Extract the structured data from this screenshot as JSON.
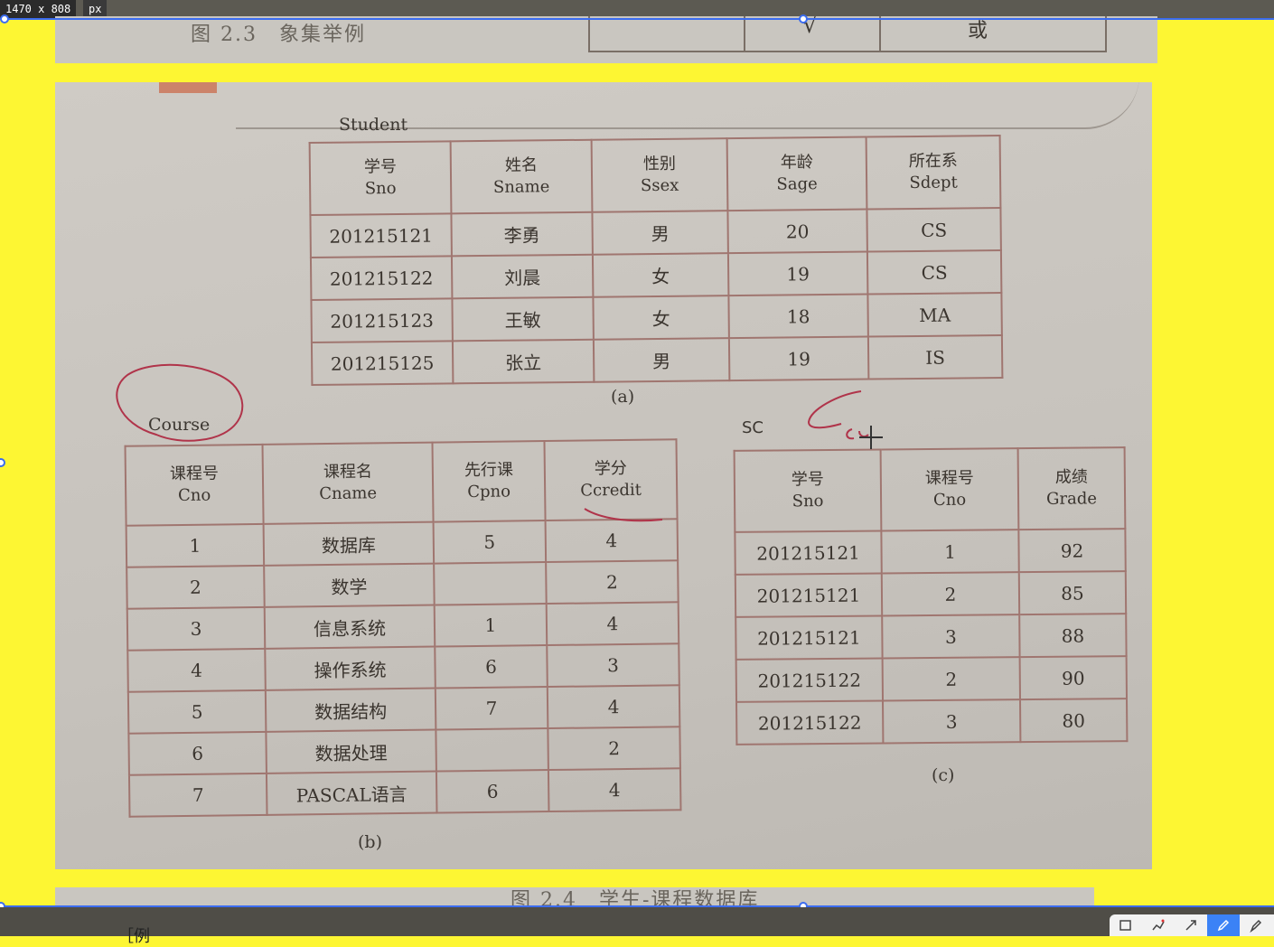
{
  "overlay": {
    "dimensions": "1470 x 808",
    "unit": "px"
  },
  "top_strip": {
    "caption": "图 2.3　象集举例",
    "table_check": "√",
    "table_or": "或"
  },
  "student": {
    "title": "Student",
    "headers": [
      {
        "cn": "学号",
        "en": "Sno"
      },
      {
        "cn": "姓名",
        "en": "Sname"
      },
      {
        "cn": "性别",
        "en": "Ssex"
      },
      {
        "cn": "年龄",
        "en": "Sage"
      },
      {
        "cn": "所在系",
        "en": "Sdept"
      }
    ],
    "rows": [
      [
        "201215121",
        "李勇",
        "男",
        "20",
        "CS"
      ],
      [
        "201215122",
        "刘晨",
        "女",
        "19",
        "CS"
      ],
      [
        "201215123",
        "王敏",
        "女",
        "18",
        "MA"
      ],
      [
        "201215125",
        "张立",
        "男",
        "19",
        "IS"
      ]
    ],
    "caption": "(a)"
  },
  "course": {
    "title": "Course",
    "headers": [
      {
        "cn": "课程号",
        "en": "Cno"
      },
      {
        "cn": "课程名",
        "en": "Cname"
      },
      {
        "cn": "先行课",
        "en": "Cpno"
      },
      {
        "cn": "学分",
        "en": "Ccredit"
      }
    ],
    "rows": [
      [
        "1",
        "数据库",
        "5",
        "4"
      ],
      [
        "2",
        "数学",
        "",
        "2"
      ],
      [
        "3",
        "信息系统",
        "1",
        "4"
      ],
      [
        "4",
        "操作系统",
        "6",
        "3"
      ],
      [
        "5",
        "数据结构",
        "7",
        "4"
      ],
      [
        "6",
        "数据处理",
        "",
        "2"
      ],
      [
        "7",
        "PASCAL语言",
        "6",
        "4"
      ]
    ],
    "caption": "(b)"
  },
  "sc": {
    "title": "SC",
    "headers": [
      {
        "cn": "学号",
        "en": "Sno"
      },
      {
        "cn": "课程号",
        "en": "Cno"
      },
      {
        "cn": "成绩",
        "en": "Grade"
      }
    ],
    "rows": [
      [
        "201215121",
        "1",
        "92"
      ],
      [
        "201215121",
        "2",
        "85"
      ],
      [
        "201215121",
        "3",
        "88"
      ],
      [
        "201215122",
        "2",
        "90"
      ],
      [
        "201215122",
        "3",
        "80"
      ]
    ],
    "caption": "(c)"
  },
  "bottom_strip": {
    "caption": "图 2.4　学生-课程数据库"
  },
  "footer": {
    "text": "［例"
  },
  "toolbar": {
    "tools": [
      "rectangle-tool-icon",
      "polyline-tool-icon",
      "arrow-tool-icon",
      "pen-tool-icon",
      "marker-tool-icon"
    ],
    "active": "pen-tool-icon"
  },
  "colors": {
    "background": "#fdf633",
    "guide": "#3b6cf0",
    "ink": "#b0344a",
    "table_border": "#a07670"
  }
}
